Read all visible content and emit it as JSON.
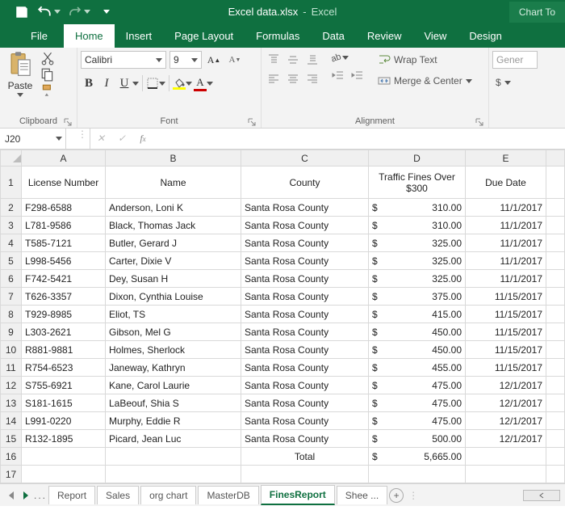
{
  "window": {
    "filename": "Excel data.xlsx",
    "app": "Excel",
    "chart_tools": "Chart To"
  },
  "tabs": {
    "file": "File",
    "home": "Home",
    "insert": "Insert",
    "page_layout": "Page Layout",
    "formulas": "Formulas",
    "data": "Data",
    "review": "Review",
    "view": "View",
    "design": "Design"
  },
  "ribbon": {
    "clipboard": {
      "paste": "Paste",
      "group": "Clipboard"
    },
    "font": {
      "name": "Calibri",
      "size": "9",
      "group": "Font"
    },
    "alignment": {
      "wrap": "Wrap Text",
      "merge": "Merge & Center",
      "group": "Alignment"
    },
    "number": {
      "fmt": "Gener",
      "currency": "$"
    }
  },
  "namebox": "J20",
  "columns": [
    "A",
    "B",
    "C",
    "D",
    "E"
  ],
  "headers": {
    "license": "License Number",
    "name": "Name",
    "county": "County",
    "fines": "Traffic Fines Over $300",
    "due": "Due Date"
  },
  "rows": [
    {
      "n": "2",
      "lic": "F298-6588",
      "name": "Anderson, Loni K",
      "county": "Santa Rosa County",
      "sym": "$",
      "amt": "310.00",
      "due": "11/1/2017"
    },
    {
      "n": "3",
      "lic": "L781-9586",
      "name": "Black, Thomas Jack",
      "county": "Santa Rosa County",
      "sym": "$",
      "amt": "310.00",
      "due": "11/1/2017"
    },
    {
      "n": "4",
      "lic": "T585-7121",
      "name": "Butler, Gerard J",
      "county": "Santa Rosa County",
      "sym": "$",
      "amt": "325.00",
      "due": "11/1/2017"
    },
    {
      "n": "5",
      "lic": "L998-5456",
      "name": "Carter, Dixie V",
      "county": "Santa Rosa County",
      "sym": "$",
      "amt": "325.00",
      "due": "11/1/2017"
    },
    {
      "n": "6",
      "lic": "F742-5421",
      "name": "Dey, Susan H",
      "county": "Santa Rosa County",
      "sym": "$",
      "amt": "325.00",
      "due": "11/1/2017"
    },
    {
      "n": "7",
      "lic": "T626-3357",
      "name": "Dixon, Cynthia Louise",
      "county": "Santa Rosa County",
      "sym": "$",
      "amt": "375.00",
      "due": "11/15/2017"
    },
    {
      "n": "8",
      "lic": "T929-8985",
      "name": "Eliot, TS",
      "county": "Santa Rosa County",
      "sym": "$",
      "amt": "415.00",
      "due": "11/15/2017"
    },
    {
      "n": "9",
      "lic": "L303-2621",
      "name": "Gibson, Mel G",
      "county": "Santa Rosa County",
      "sym": "$",
      "amt": "450.00",
      "due": "11/15/2017"
    },
    {
      "n": "10",
      "lic": "R881-9881",
      "name": "Holmes, Sherlock",
      "county": "Santa Rosa County",
      "sym": "$",
      "amt": "450.00",
      "due": "11/15/2017"
    },
    {
      "n": "11",
      "lic": "R754-6523",
      "name": "Janeway, Kathryn",
      "county": "Santa Rosa County",
      "sym": "$",
      "amt": "455.00",
      "due": "11/15/2017"
    },
    {
      "n": "12",
      "lic": "S755-6921",
      "name": "Kane, Carol Laurie",
      "county": "Santa Rosa County",
      "sym": "$",
      "amt": "475.00",
      "due": "12/1/2017"
    },
    {
      "n": "13",
      "lic": "S181-1615",
      "name": "LaBeouf, Shia S",
      "county": "Santa Rosa County",
      "sym": "$",
      "amt": "475.00",
      "due": "12/1/2017"
    },
    {
      "n": "14",
      "lic": "L991-0220",
      "name": "Murphy, Eddie R",
      "county": "Santa Rosa County",
      "sym": "$",
      "amt": "475.00",
      "due": "12/1/2017"
    },
    {
      "n": "15",
      "lic": "R132-1895",
      "name": "Picard, Jean Luc",
      "county": "Santa Rosa County",
      "sym": "$",
      "amt": "500.00",
      "due": "12/1/2017"
    }
  ],
  "total": {
    "n": "16",
    "label": "Total",
    "sym": "$",
    "amt": "5,665.00"
  },
  "empty_rows": [
    "17"
  ],
  "sheets": {
    "ell": "...",
    "report": "Report",
    "sales": "Sales",
    "org": "org chart",
    "master": "MasterDB",
    "fines": "FinesReport",
    "shee": "Shee ..."
  }
}
